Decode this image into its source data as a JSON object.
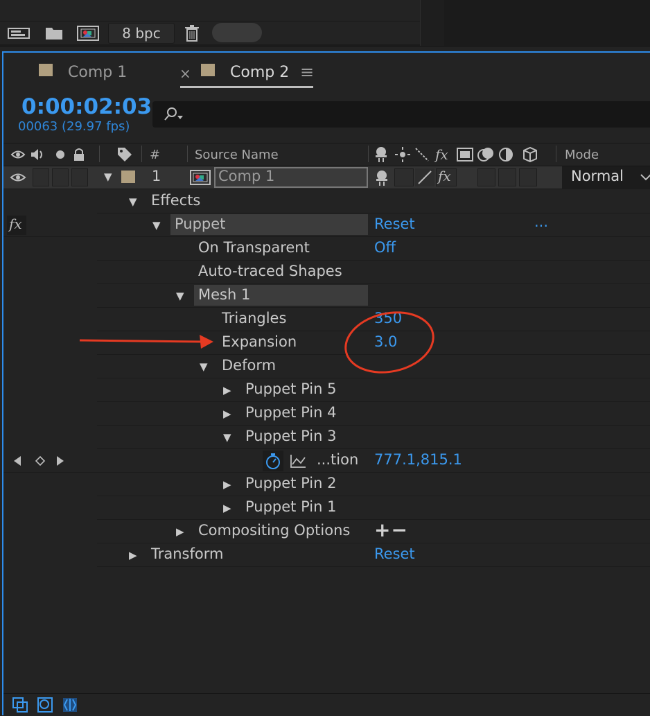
{
  "project_toolbar": {
    "icons": [
      "interpret-footage-icon",
      "folder-icon",
      "new-composition-icon",
      "trash-icon"
    ],
    "bpc_label": "8 bpc"
  },
  "tabs": [
    {
      "label": "Comp 1",
      "active": false
    },
    {
      "label": "Comp 2",
      "active": true
    }
  ],
  "tab_close": "×",
  "tab_menu": "≡",
  "timecode": "0:00:02:03",
  "frame_info": "00063 (29.97 fps)",
  "search": {
    "placeholder": ""
  },
  "columns": {
    "number": "#",
    "source_name": "Source Name",
    "mode": "Mode"
  },
  "layer": {
    "index": "1",
    "name": "Comp 1",
    "mode": "Normal"
  },
  "tree": {
    "effects": "Effects",
    "puppet": "Puppet",
    "puppet_reset": "Reset",
    "puppet_more": "...",
    "fx": "fx",
    "on_transparent": "On Transparent",
    "on_transparent_value": "Off",
    "auto_traced": "Auto-traced Shapes",
    "mesh": "Mesh 1",
    "triangles": "Triangles",
    "triangles_value": "350",
    "expansion": "Expansion",
    "expansion_value": "3.0",
    "deform": "Deform",
    "pin5": "Puppet Pin 5",
    "pin4": "Puppet Pin 4",
    "pin3": "Puppet Pin 3",
    "position_label": "...tion",
    "position_value": "777.1,815.1",
    "pin2": "Puppet Pin 2",
    "pin1": "Puppet Pin 1",
    "compositing": "Compositing Options",
    "compositing_ops": "+−",
    "transform": "Transform",
    "transform_reset": "Reset"
  },
  "colors": {
    "accent_blue": "#3b99ef",
    "annotation_red": "#e53a22",
    "panel_bg": "#232323"
  }
}
